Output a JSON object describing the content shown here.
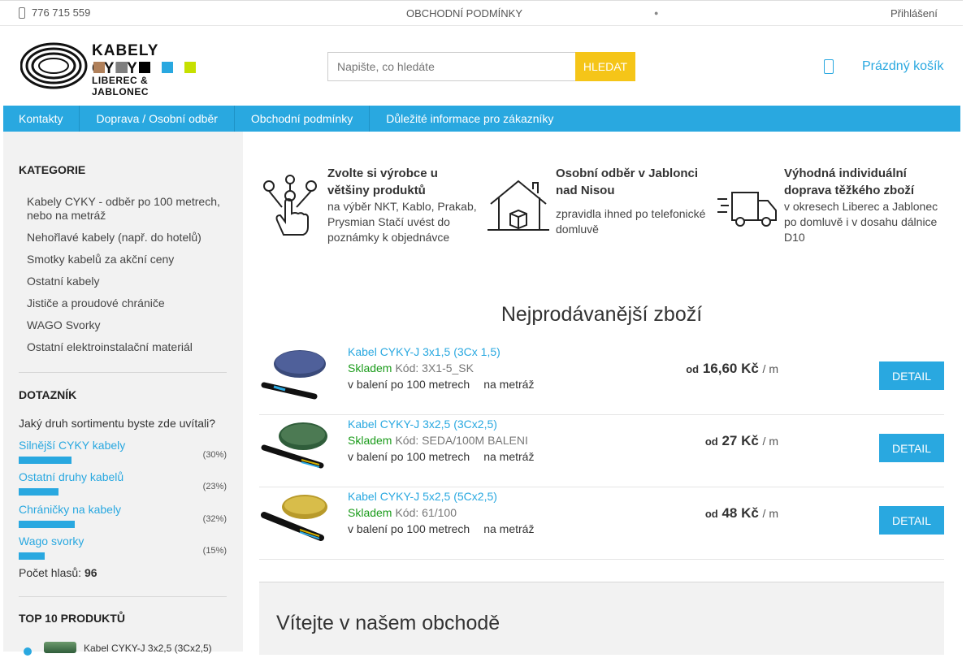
{
  "topbar": {
    "phone": "776 715 559",
    "terms": "OBCHODNÍ PODMÍNKY",
    "login": "Přihlášení"
  },
  "header": {
    "logo_title": "KABELY CYKY",
    "logo_subtitle": "LIBEREC & JABLONEC",
    "logo_colors": [
      "#b0805a",
      "#7f7f7f",
      "#000000",
      "#29a8e0",
      "#c6e000"
    ],
    "search_placeholder": "Napište, co hledáte",
    "search_button": "HLEDAT",
    "cart_label": "Prázdný košík",
    "cart_icon": "cart-icon"
  },
  "nav": [
    "Kontakty",
    "Doprava / Osobní odběr",
    "Obchodní podmínky",
    "Důležité informace pro zákazníky"
  ],
  "sidebar": {
    "categories_title": "KATEGORIE",
    "categories": [
      "Kabely CYKY - odběr po 100 metrech, nebo na metráž",
      "Nehořlavé kabely (např. do hotelů)",
      "Smotky kabelů za akční ceny",
      "Ostatní kabely",
      "Jističe a proudové chrániče",
      "WAGO Svorky",
      "Ostatní elektroinstalační materiál"
    ],
    "poll_title": "DOTAZNÍK",
    "poll_question": "Jaký druh sortimentu byste zde uvítali?",
    "poll_items": [
      {
        "label": "Silnější CYKY kabely",
        "pct": "(30%)",
        "value": 30
      },
      {
        "label": "Ostatní druhy kabelů",
        "pct": "(23%)",
        "value": 23
      },
      {
        "label": "Chráničky na kabely",
        "pct": "(32%)",
        "value": 32
      },
      {
        "label": "Wago svorky",
        "pct": "(15%)",
        "value": 15
      }
    ],
    "votes_label": "Počet hlasů:",
    "votes_count": "96",
    "top10_title": "TOP 10 PRODUKTŮ",
    "top10_first": "Kabel CYKY-J 3x2,5 (3Cx2,5)"
  },
  "features": [
    {
      "title": "Zvolte si výrobce u většiny produktů",
      "text": "na výběr NKT, Kablo, Prakab, Prysmian Stačí uvést do poznámky k objednávce",
      "icon": "hand-choice-icon"
    },
    {
      "title": "Osobní odběr v Jablonci nad Nisou",
      "text": "zpravidla ihned po telefonické domluvě",
      "icon": "house-package-icon"
    },
    {
      "title": "Výhodná individuální doprava těžkého zboží",
      "text": "v okresech Liberec a Jablonec po domluvě i v dosahu dálnice D10",
      "icon": "delivery-truck-icon"
    }
  ],
  "bestsellers_title": "Nejprodávanější zboží",
  "products": [
    {
      "name": "Kabel CYKY-J 3x1,5 (3Cx 1,5)",
      "stock": "Skladem",
      "code": "Kód: 3X1-5_SK",
      "pack1": "v balení po 100 metrech",
      "pack2": "na metráž",
      "od": "od",
      "price": "16,60 Kč",
      "unit": "/ m",
      "button": "DETAIL",
      "sheath": "#3a4a7a"
    },
    {
      "name": "Kabel CYKY-J 3x2,5 (3Cx2,5)",
      "stock": "Skladem",
      "code": "Kód: SEDA/100M BALENI",
      "pack1": "v balení po 100 metrech",
      "pack2": "na metráž",
      "od": "od",
      "price": "27 Kč",
      "unit": "/ m",
      "button": "DETAIL",
      "sheath": "#2f5d3a"
    },
    {
      "name": "Kabel CYKY-J 5x2,5 (5Cx2,5)",
      "stock": "Skladem",
      "code": "Kód: 61/100",
      "pack1": "v balení po 100 metrech",
      "pack2": "na metráž",
      "od": "od",
      "price": "48 Kč",
      "unit": "/ m",
      "button": "DETAIL",
      "sheath": "#b89a2a"
    }
  ],
  "welcome_title": "Vítejte v našem obchodě"
}
